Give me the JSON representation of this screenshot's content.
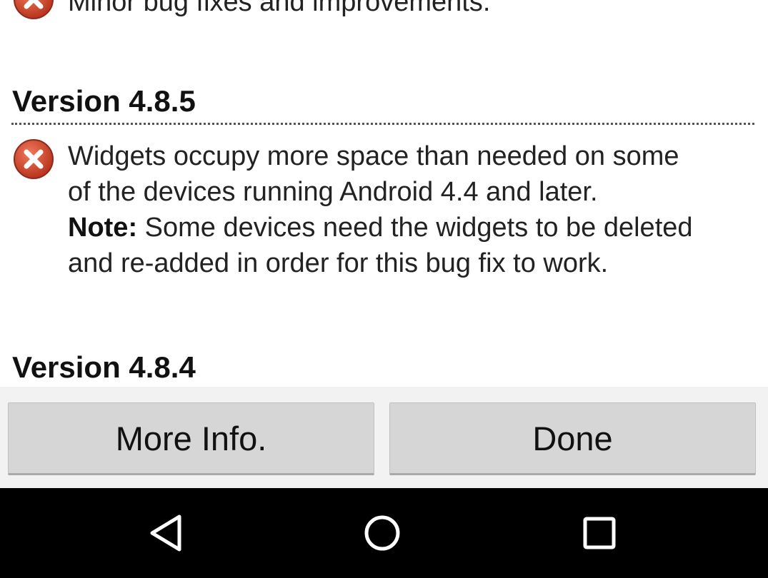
{
  "changelog": {
    "previous_entry": {
      "icon": "bug-fix-x-icon",
      "text": "Minor bug fixes and improvements."
    },
    "versions": [
      {
        "title": "Version 4.8.5",
        "entries": [
          {
            "icon": "bug-fix-x-icon",
            "line1": "Widgets occupy more space than needed on some",
            "line2": "of the devices running Android 4.4 and later.",
            "note_label": "Note:",
            "note_line1": " Some devices need the widgets to be deleted",
            "note_line2": "and re-added in order for this bug fix to work."
          }
        ]
      },
      {
        "title": "Version 4.8.4",
        "entries": []
      }
    ]
  },
  "buttons": {
    "more_info": "More Info.",
    "done": "Done"
  },
  "navigation": {
    "back": "back-triangle-icon",
    "home": "home-circle-icon",
    "recents": "recents-square-icon"
  },
  "colors": {
    "icon_red": "#d2452b",
    "button_bg": "#d6d6d6",
    "nav_bar": "#000000"
  }
}
